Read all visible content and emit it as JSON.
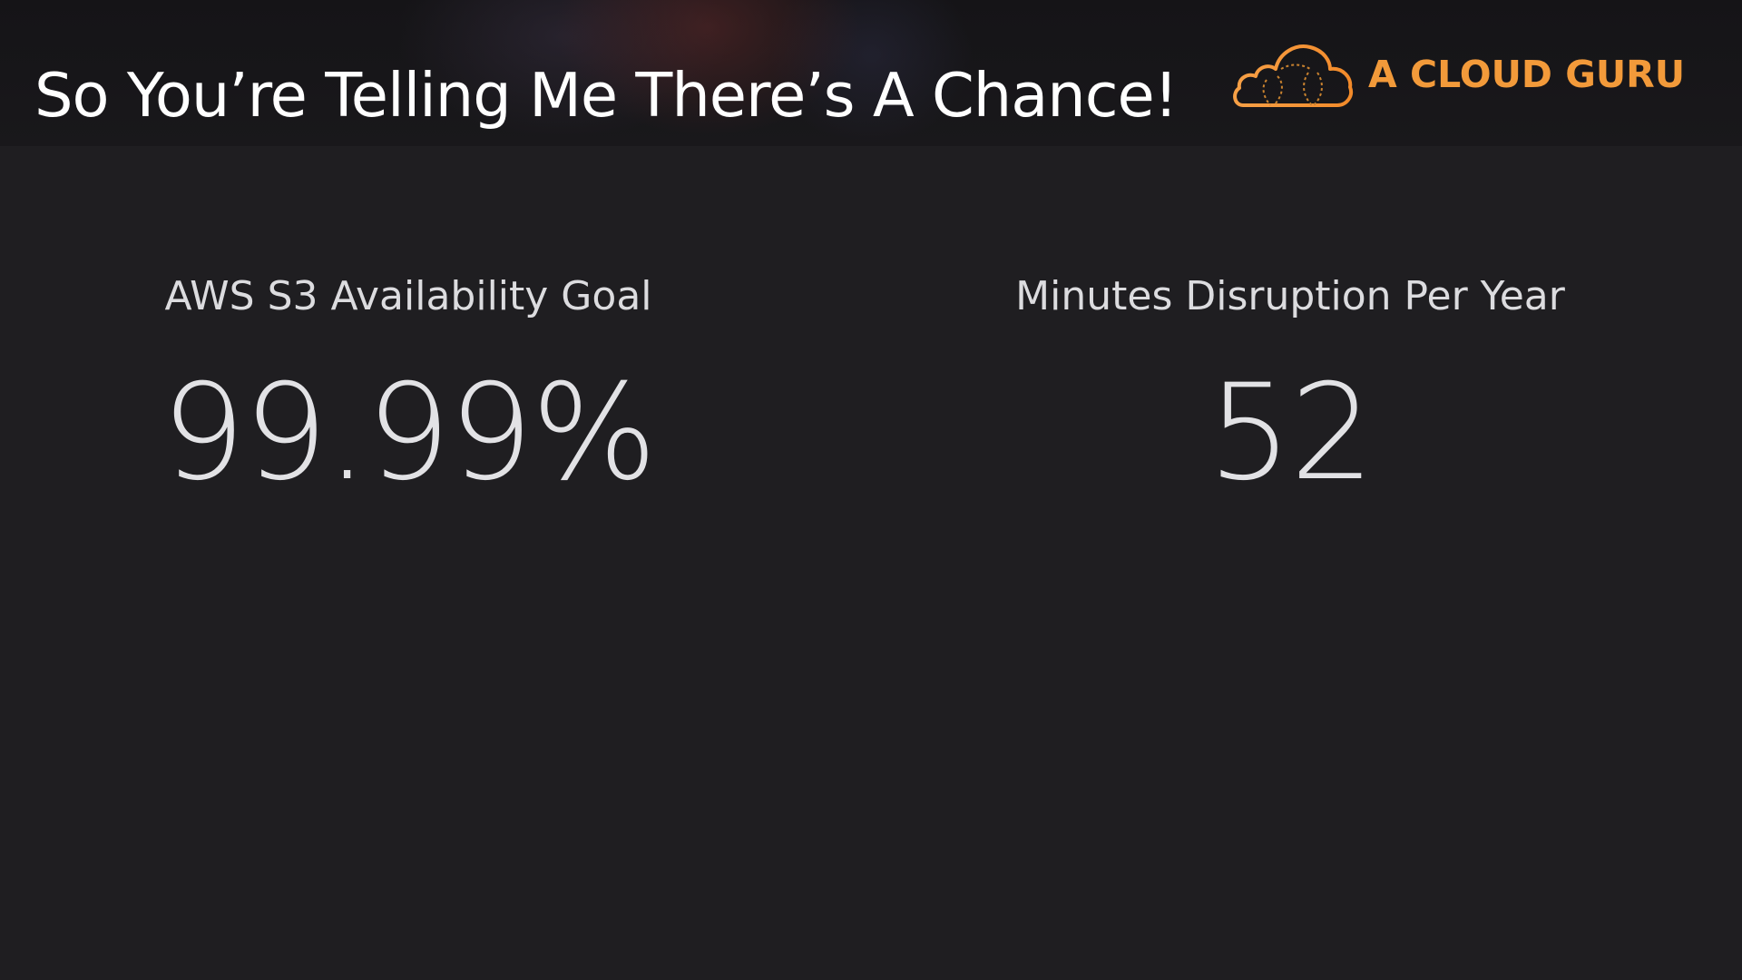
{
  "slide": {
    "title": "So You’re Telling Me There’s A Chance!"
  },
  "brand": {
    "name": "A CLOUD GURU",
    "logo_icon": "cloud-logo-icon",
    "color": "#f29a3a"
  },
  "stats": [
    {
      "label": "AWS S3 Availability Goal",
      "value": "99.99%"
    },
    {
      "label": "Minutes Disruption Per Year",
      "value": "52"
    }
  ]
}
